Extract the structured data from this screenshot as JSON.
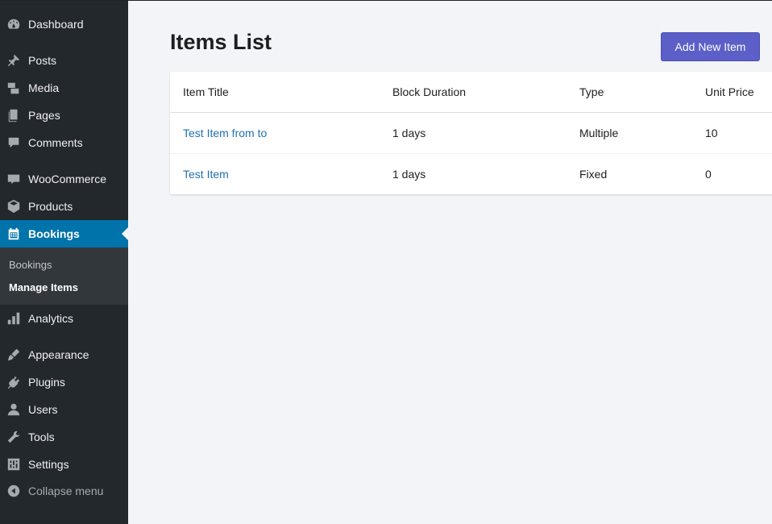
{
  "sidebar": {
    "items": [
      {
        "label": "Dashboard",
        "icon": "dashboard-icon"
      },
      {
        "label": "Posts",
        "icon": "pin-icon"
      },
      {
        "label": "Media",
        "icon": "media-icon"
      },
      {
        "label": "Pages",
        "icon": "pages-icon"
      },
      {
        "label": "Comments",
        "icon": "comment-icon"
      },
      {
        "label": "WooCommerce",
        "icon": "woo-icon"
      },
      {
        "label": "Products",
        "icon": "box-icon"
      },
      {
        "label": "Bookings",
        "icon": "calendar-icon"
      },
      {
        "label": "Analytics",
        "icon": "bar-chart-icon"
      },
      {
        "label": "Appearance",
        "icon": "paintbrush-icon"
      },
      {
        "label": "Plugins",
        "icon": "plug-icon"
      },
      {
        "label": "Users",
        "icon": "user-icon"
      },
      {
        "label": "Tools",
        "icon": "wrench-icon"
      },
      {
        "label": "Settings",
        "icon": "settings-icon"
      },
      {
        "label": "Collapse menu",
        "icon": "collapse-icon"
      }
    ],
    "submenu": [
      "Bookings",
      "Manage Items"
    ],
    "colors": {
      "background": "#23282d",
      "active": "#0073aa",
      "submenu": "#32373c"
    }
  },
  "main": {
    "title": "Items List",
    "add_button": "Add New Item",
    "accent": "#5b5fc7",
    "table": {
      "headers": [
        "Item Title",
        "Block Duration",
        "Type",
        "Unit Price"
      ],
      "rows": [
        [
          "Test Item from to",
          "1 days",
          "Multiple",
          "10"
        ],
        [
          "Test Item",
          "1 days",
          "Fixed",
          "0"
        ]
      ]
    }
  }
}
